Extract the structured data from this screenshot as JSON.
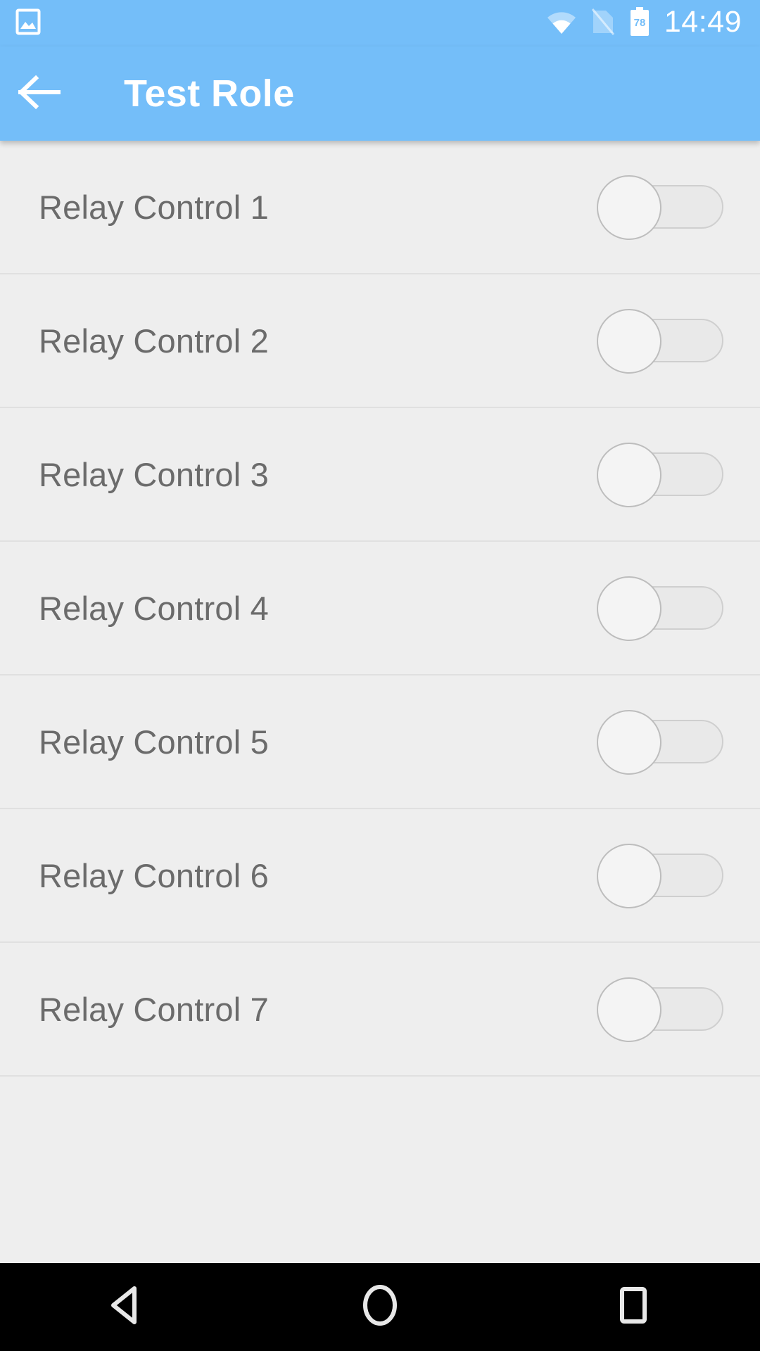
{
  "status_bar": {
    "notification_icon": "image-icon",
    "wifi_icon": "wifi-icon",
    "sim_icon": "no-sim-icon",
    "battery_icon": "battery-icon",
    "battery_level": "78",
    "clock": "14:49"
  },
  "app_bar": {
    "back_icon": "back-arrow-icon",
    "title": "Test Role"
  },
  "list": {
    "rows": [
      {
        "label": "Relay Control 1",
        "state": "off"
      },
      {
        "label": "Relay Control 2",
        "state": "off"
      },
      {
        "label": "Relay Control 3",
        "state": "off"
      },
      {
        "label": "Relay Control 4",
        "state": "off"
      },
      {
        "label": "Relay Control 5",
        "state": "off"
      },
      {
        "label": "Relay Control 6",
        "state": "off"
      },
      {
        "label": "Relay Control 7",
        "state": "off"
      }
    ]
  },
  "nav_bar": {
    "back_icon": "nav-back-triangle-icon",
    "home_icon": "nav-home-circle-icon",
    "recents_icon": "nav-recents-square-icon"
  },
  "colors": {
    "accent": "#74bef9",
    "background": "#eeeeee",
    "label_text": "#6b6b6b",
    "divider": "#e0e0e0",
    "nav_background": "#000000"
  }
}
